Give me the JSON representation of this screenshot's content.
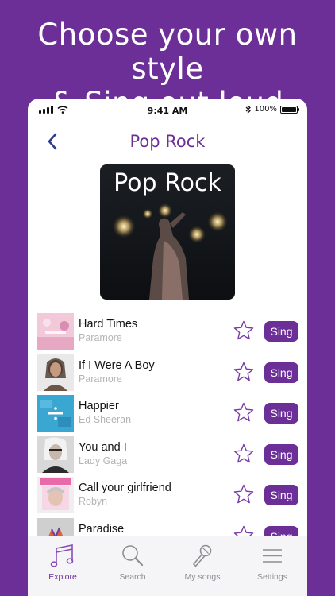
{
  "headline": {
    "line1": "Choose your own style",
    "line2": "& Sing out loud"
  },
  "status_bar": {
    "time": "9:41 AM",
    "battery": "100%"
  },
  "nav": {
    "title": "Pop Rock",
    "back_icon": "chevron-left-icon"
  },
  "cover": {
    "title": "Pop Rock"
  },
  "songs": [
    {
      "title": "Hard Times",
      "artist": "Paramore",
      "action": "Sing"
    },
    {
      "title": "If I Were A Boy",
      "artist": "Paramore",
      "action": "Sing"
    },
    {
      "title": "Happier",
      "artist": "Ed Sheeran",
      "action": "Sing"
    },
    {
      "title": "You and I",
      "artist": "Lady Gaga",
      "action": "Sing"
    },
    {
      "title": "Call your girlfriend",
      "artist": "Robyn",
      "action": "Sing"
    },
    {
      "title": "Paradise",
      "artist": "",
      "action": "Sing"
    }
  ],
  "tabs": [
    {
      "label": "Explore",
      "icon": "music-notes-icon",
      "active": true
    },
    {
      "label": "Search",
      "icon": "search-icon",
      "active": false
    },
    {
      "label": "My songs",
      "icon": "microphone-icon",
      "active": false
    },
    {
      "label": "Settings",
      "icon": "menu-icon",
      "active": false
    }
  ],
  "colors": {
    "brand": "#6c2f98",
    "tab_inactive": "#8e8e93",
    "artist_text": "#b4b4b4"
  }
}
